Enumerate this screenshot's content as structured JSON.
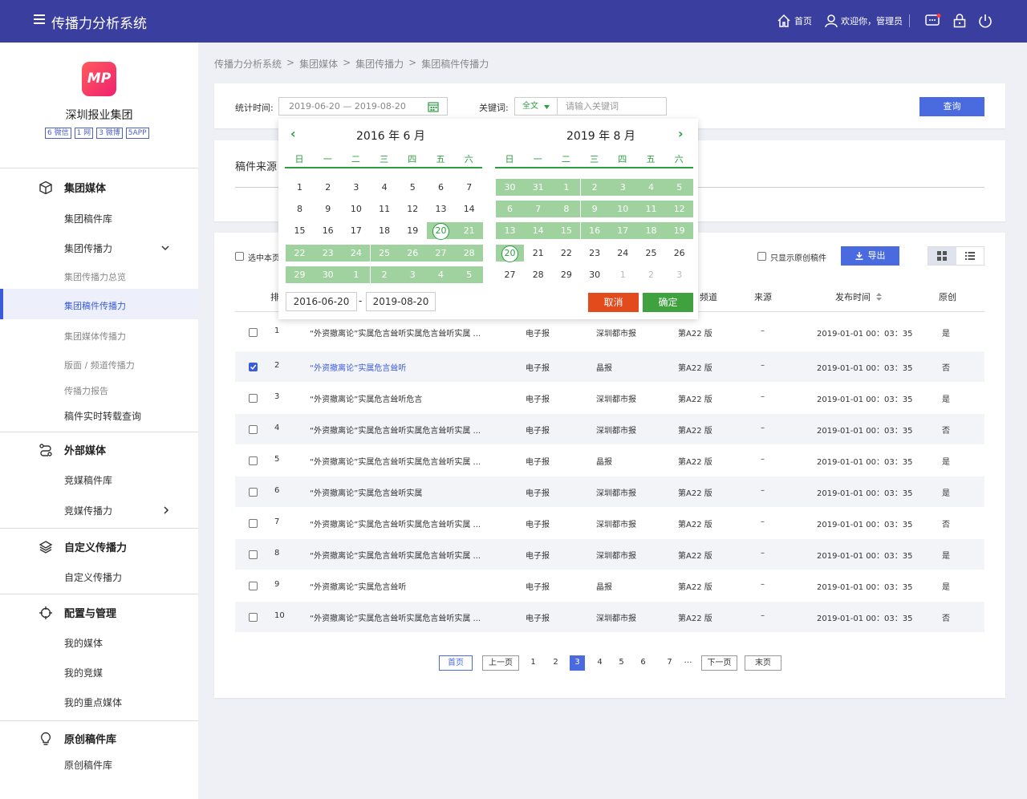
{
  "topbar": {
    "title": "传播力分析系统",
    "home": "首页",
    "user": "欢迎你，管理员"
  },
  "sidebar": {
    "org": "深圳报业集团",
    "logo_text": "MP",
    "badges": [
      "6 微信",
      "1 网",
      "3 微博",
      "5APP"
    ],
    "sections": [
      {
        "label": "集团媒体",
        "items": [
          "集团稿件库",
          "集团传播力",
          "集团传播力总览",
          "集团稿件传播力",
          "集团媒体传播力",
          "版面 / 频道传播力",
          "传播力报告",
          "稿件实时转载查询"
        ]
      },
      {
        "label": "外部媒体",
        "items": [
          "竞媒稿件库",
          "竞媒传播力"
        ]
      },
      {
        "label": "自定义传播力",
        "items": [
          "自定义传播力"
        ]
      },
      {
        "label": "配置与管理",
        "items": [
          "我的媒体",
          "我的竞媒",
          "我的重点媒体"
        ]
      },
      {
        "label": "原创稿件库",
        "items": [
          "原创稿件库"
        ]
      }
    ]
  },
  "breadcrumb": [
    "传播力分析系统",
    ">",
    "集团媒体",
    ">",
    "集团传播力",
    ">",
    "集团稿件传播力"
  ],
  "filter": {
    "time_label": "统计时间:",
    "date_range": "2019-06-20  — 2019-08-20",
    "keyword_label": "关键词:",
    "keyword_scope": "全文",
    "keyword_placeholder": "请输入关键词",
    "query": "查询"
  },
  "source": {
    "label": "稿件来源"
  },
  "toolbar": {
    "select_page": "选中本页",
    "only_original": "只显示原创稿件",
    "export": "导出"
  },
  "table": {
    "headers": {
      "rank": "排",
      "channel": "频道",
      "source": "来源",
      "time": "发布时间",
      "original": "原创"
    },
    "rows": [
      {
        "no": "1",
        "title": "“外资撤离论”实属危言耸听实属危言耸听实属 ...",
        "type": "电子报",
        "media": "深圳都市报",
        "page": "第A22 版",
        "source": "–",
        "time": "2019-01-01 00：03：35",
        "orig": "是"
      },
      {
        "no": "2",
        "title": "“外资撤离论”实属危言耸听",
        "type": "电子报",
        "media": "晶报",
        "page": "第A22 版",
        "source": "–",
        "time": "2019-01-01 00：03：35",
        "orig": "否"
      },
      {
        "no": "3",
        "title": "“外资撤离论”实属危言耸听危言",
        "type": "电子报",
        "media": "深圳都市报",
        "page": "第A22 版",
        "source": "–",
        "time": "2019-01-01 00：03：35",
        "orig": "是"
      },
      {
        "no": "4",
        "title": "“外资撤离论”实属危言耸听实属危言耸听实属 ...",
        "type": "电子报",
        "media": "深圳都市报",
        "page": "第A22 版",
        "source": "–",
        "time": "2019-01-01 00：03：35",
        "orig": "否"
      },
      {
        "no": "5",
        "title": "“外资撤离论”实属危言耸听实属危言耸听实属 ...",
        "type": "电子报",
        "media": "晶报",
        "page": "第A22 版",
        "source": "–",
        "time": "2019-01-01 00：03：35",
        "orig": "是"
      },
      {
        "no": "6",
        "title": "“外资撤离论”实属危言耸听实属",
        "type": "电子报",
        "media": "深圳都市报",
        "page": "第A22 版",
        "source": "–",
        "time": "2019-01-01 00：03：35",
        "orig": "是"
      },
      {
        "no": "7",
        "title": "“外资撤离论”实属危言耸听实属危言耸听实属 ...",
        "type": "电子报",
        "media": "深圳都市报",
        "page": "第A22 版",
        "source": "–",
        "time": "2019-01-01 00：03：35",
        "orig": "否"
      },
      {
        "no": "8",
        "title": "“外资撤离论”实属危言耸听实属危言耸听实属 ...",
        "type": "电子报",
        "media": "深圳都市报",
        "page": "第A22 版",
        "source": "–",
        "time": "2019-01-01 00：03：35",
        "orig": "是"
      },
      {
        "no": "9",
        "title": "“外资撤离论”实属危言耸听",
        "type": "电子报",
        "media": "晶报",
        "page": "第A22 版",
        "source": "–",
        "time": "2019-01-01 00：03：35",
        "orig": "是"
      },
      {
        "no": "10",
        "title": "“外资撤离论”实属危言耸听实属危言耸听实属 ...",
        "type": "电子报",
        "media": "深圳都市报",
        "page": "第A22 版",
        "source": "–",
        "time": "2019-01-01 00：03：35",
        "orig": "否"
      }
    ]
  },
  "pagination": {
    "first": "首页",
    "prev": "上一页",
    "pages": [
      "1",
      "2",
      "3",
      "4",
      "5",
      "6",
      "7"
    ],
    "ellipsis": "…",
    "next": "下一页",
    "last": "末页",
    "current": "3"
  },
  "calendar": {
    "left_title": "2016 年 6 月",
    "right_title": "2019 年 8 月",
    "weekdays": [
      "日",
      "一",
      "二",
      "三",
      "四",
      "五",
      "六"
    ],
    "left_weeks": [
      [
        "1",
        "2",
        "3",
        "4",
        "5",
        "6",
        "7"
      ],
      [
        "8",
        "9",
        "10",
        "11",
        "12",
        "13",
        "14"
      ],
      [
        "15",
        "16",
        "17",
        "18",
        "19",
        "20",
        "21"
      ],
      [
        "22",
        "23",
        "24",
        "25",
        "26",
        "27",
        "28"
      ],
      [
        "29",
        "30",
        "1",
        "2",
        "3",
        "4",
        "5"
      ]
    ],
    "right_weeks": [
      [
        "30",
        "31",
        "1",
        "2",
        "3",
        "4",
        "5"
      ],
      [
        "6",
        "7",
        "8",
        "9",
        "10",
        "11",
        "12"
      ],
      [
        "13",
        "14",
        "15",
        "16",
        "17",
        "18",
        "19"
      ],
      [
        "20",
        "21",
        "22",
        "23",
        "24",
        "25",
        "26"
      ],
      [
        "27",
        "28",
        "29",
        "30",
        "1",
        "2",
        "3"
      ]
    ],
    "start_input": "2016-06-20",
    "dash": "-",
    "end_input": "2019-08-20",
    "cancel": "取消",
    "confirm": "确定"
  },
  "colors": {
    "topbar": "#3a3f9f",
    "accent": "#3b5bdb",
    "calendar_green": "#2b9e3f",
    "range_fill": "#9fd29f",
    "cancel": "#e34a1c",
    "confirm": "#3fa23f"
  }
}
